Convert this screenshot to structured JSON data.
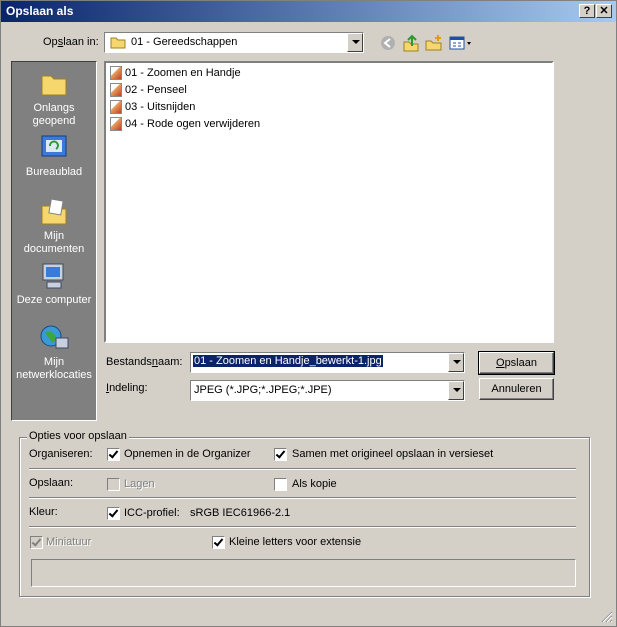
{
  "window": {
    "title": "Opslaan als",
    "help_glyph": "?",
    "close_glyph": "✕"
  },
  "savein": {
    "label_pre": "Op",
    "label_u": "s",
    "label_post": "laan in:",
    "value": "01 - Gereedschappen"
  },
  "toolbar": {
    "icons": [
      "back-icon",
      "up-folder-icon",
      "new-folder-icon",
      "view-menu-icon"
    ]
  },
  "places": [
    {
      "label1": "Onlangs",
      "label2": "geopend"
    },
    {
      "label1": "Bureaublad",
      "label2": ""
    },
    {
      "label1": "Mijn",
      "label2": "documenten"
    },
    {
      "label1": "Deze computer",
      "label2": ""
    },
    {
      "label1": "Mijn",
      "label2": "netwerklocaties"
    }
  ],
  "files": [
    "01 - Zoomen en Handje",
    "02 - Penseel",
    "03 - Uitsnijden",
    "04 - Rode ogen verwijderen"
  ],
  "filename": {
    "label_pre": "Bestands",
    "label_u": "n",
    "label_post": "aam:",
    "value": "01 - Zoomen en Handje_bewerkt-1.jpg"
  },
  "format": {
    "label_pre": "",
    "label_u": "I",
    "label_post": "ndeling:",
    "value": "JPEG (*.JPG;*.JPEG;*.JPE)"
  },
  "buttons": {
    "save_u": "O",
    "save_rest": "pslaan",
    "cancel": "Annuleren"
  },
  "options": {
    "legend": "Opties voor opslaan",
    "organize_label": "Organiseren:",
    "include_organizer": "Opnemen in de Organizer",
    "version_set": "Samen met origineel opslaan in versieset",
    "save_label": "Opslaan:",
    "layers": "Lagen",
    "as_copy": "Als kopie",
    "color_label": "Kleur:",
    "icc_profile": "ICC-profiel:",
    "icc_value": "sRGB IEC61966-2.1",
    "thumbnail": "Miniatuur",
    "lowercase_ext": "Kleine letters voor extensie"
  }
}
